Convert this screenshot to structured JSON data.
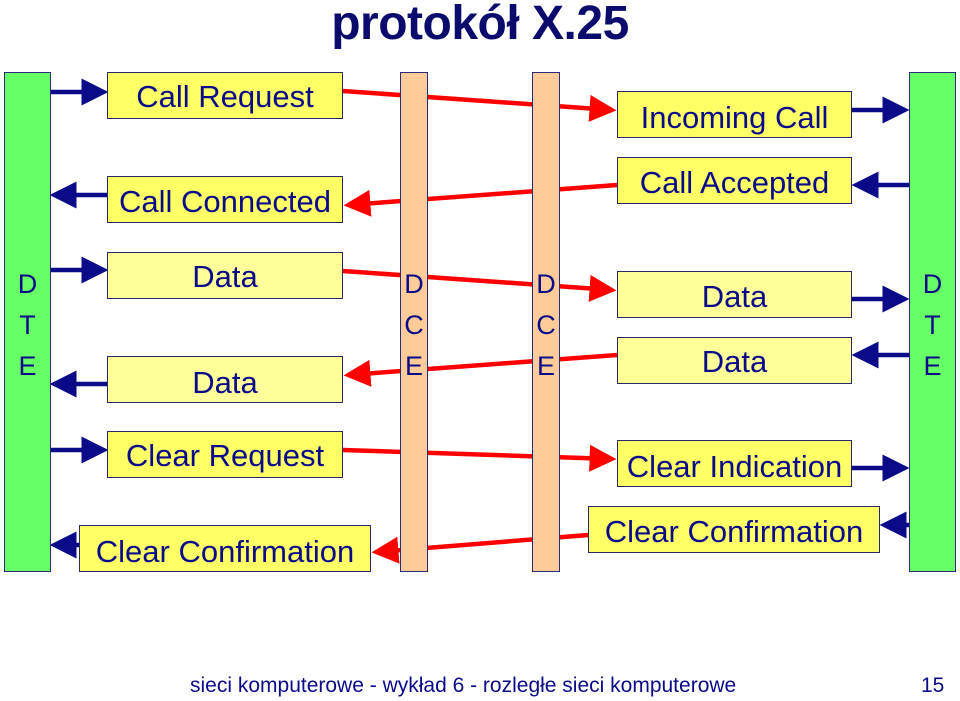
{
  "title": "protokół X.25",
  "entities": {
    "left_dte": [
      "D",
      "T",
      "E"
    ],
    "left_dce": [
      "D",
      "C",
      "E"
    ],
    "right_dce": [
      "D",
      "C",
      "E"
    ],
    "right_dte": [
      "D",
      "T",
      "E"
    ]
  },
  "left_packets": [
    {
      "label": "Call Request",
      "direction": "to-network"
    },
    {
      "label": "Call Connected",
      "direction": "to-dte"
    },
    {
      "label": "Data",
      "direction": "to-network"
    },
    {
      "label": "Data",
      "direction": "to-dte"
    },
    {
      "label": "Clear Request",
      "direction": "to-network"
    },
    {
      "label": "Clear Confirmation",
      "direction": "to-dte"
    }
  ],
  "right_packets": [
    {
      "label": "Incoming Call",
      "direction": "to-dte"
    },
    {
      "label": "Call Accepted",
      "direction": "to-network"
    },
    {
      "label": "Data",
      "direction": "to-dte"
    },
    {
      "label": "Data",
      "direction": "to-network"
    },
    {
      "label": "Clear Indication",
      "direction": "to-dte"
    },
    {
      "label": "Clear Confirmation",
      "direction": "to-network"
    }
  ],
  "colors": {
    "title": "#0b0b6e",
    "dte": "#66ff66",
    "dce": "#ffcc99",
    "packet_box": "#ffff66",
    "packet_box_data": "#ffff99",
    "local_arrow": "#0b0b8a",
    "network_arrow": "#ff0000"
  },
  "footer": {
    "text": "sieci komputerowe - wykład 6 - rozległe sieci komputerowe",
    "page_number": "15"
  }
}
